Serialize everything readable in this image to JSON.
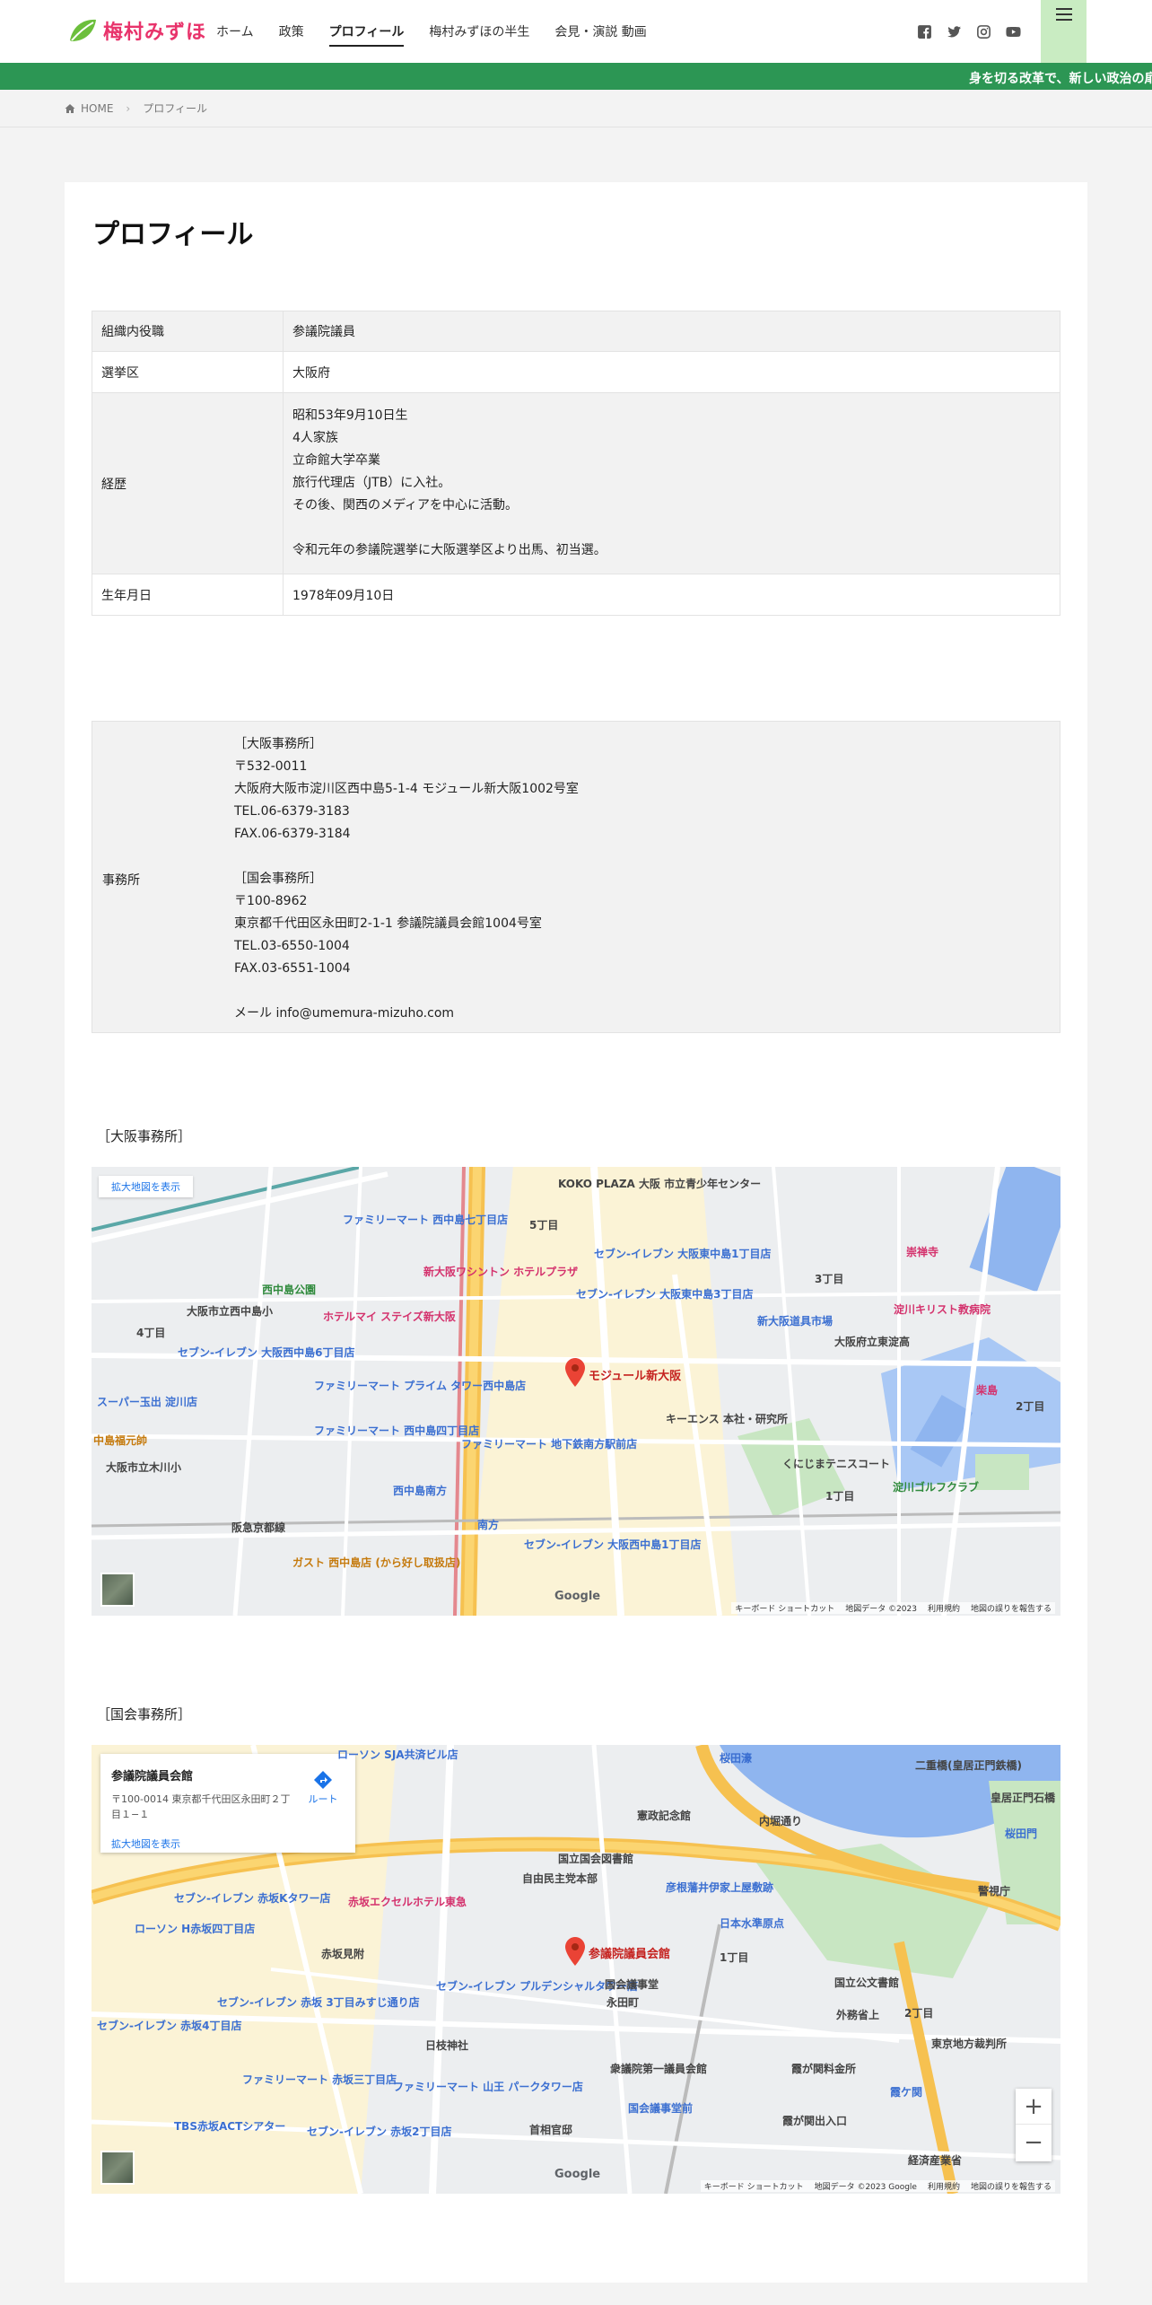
{
  "header": {
    "logo_text": "梅村みずほ",
    "nav": [
      "ホーム",
      "政策",
      "プロフィール",
      "梅村みずほの半生",
      "会見・演説 動画"
    ],
    "active_nav": "プロフィール"
  },
  "ticker": {
    "text": "身を切る改革で、新しい政治の扉"
  },
  "breadcrumb": {
    "home": "HOME",
    "current": "プロフィール"
  },
  "page": {
    "title": "プロフィール"
  },
  "profile_table": {
    "rows": [
      {
        "label": "組織内役職",
        "value": "参議院議員"
      },
      {
        "label": "選挙区",
        "value": "大阪府"
      },
      {
        "label": "経歴",
        "lines": [
          "昭和53年9月10日生",
          "4人家族",
          "立命館大学卒業",
          "旅行代理店（JTB）に入社。",
          "その後、関西のメディアを中心に活動。",
          "",
          "令和元年の参議院選挙に大阪選挙区より出馬、初当選。"
        ]
      },
      {
        "label": "生年月日",
        "value": "1978年09月10日"
      }
    ]
  },
  "office_table": {
    "label": "事務所",
    "lines": [
      "［大阪事務所］",
      "〒532-0011",
      "大阪府大阪市淀川区西中島5-1-4 モジュール新大阪1002号室",
      "TEL.06-6379-3183",
      "FAX.06-6379-3184",
      "",
      "［国会事務所］",
      "〒100-8962",
      "東京都千代田区永田町2-1-1 参議院議員会館1004号室",
      "TEL.03-6550-1004",
      "FAX.03-6551-1004",
      "",
      "メール info@umemura-mizuho.com"
    ]
  },
  "map_osaka": {
    "heading": "［大阪事務所］",
    "enlarge": "拡大地図を表示",
    "marker": "モジュール新大阪",
    "labels": [
      "ファミリーマート 西中島七丁目店",
      "KOKO PLAZA 大阪 市立青少年センター",
      "新大阪ワシントン ホテルプラザ",
      "セブン-イレブン 大阪東中島1丁目店",
      "セブン-イレブン 大阪東中島3丁目店",
      "崇禅寺",
      "淀川キリスト教病院",
      "新大阪道具市場",
      "大阪府立東淀高",
      "ホテルマイ ステイズ新大阪",
      "西中島公園",
      "大阪市立西中島小",
      "セブン-イレブン 大阪西中島6丁目店",
      "ファミリーマート プライム タワー西中島店",
      "スーパー玉出 淀川店",
      "キーエンス 本社・研究所",
      "くにじまテニスコート",
      "柴島",
      "ファミリーマート 西中島四丁目店",
      "ファミリーマート 地下鉄南方駅前店",
      "大阪市立木川小",
      "中島福元帥",
      "西中島南方",
      "南方",
      "阪急京都線",
      "セブン-イレブン 大阪西中島1丁目店",
      "淀川ゴルフクラブ",
      "ガスト 西中島店 (から好し取扱店)",
      "5丁目",
      "3丁目",
      "4丁目",
      "2丁目",
      "1丁目"
    ],
    "google": "Google",
    "footer": [
      "キーボード ショートカット",
      "地図データ ©2023",
      "利用規約",
      "地図の誤りを報告する"
    ]
  },
  "map_kokkai": {
    "heading": "［国会事務所］",
    "info_title": "参議院議員会館",
    "info_address": "〒100-0014 東京都千代田区永田町２丁目１−１",
    "info_route": "ルート",
    "enlarge": "拡大地図を表示",
    "marker": "参議院議員会館",
    "labels": [
      "ローソン SJA共済ビル店",
      "桜田濠",
      "憲政記念館",
      "内堀通り",
      "二重橋(皇居正門鉄橋)",
      "皇居正門石橋",
      "桜田門",
      "警視庁",
      "国立国会図書館",
      "自由民主党本部",
      "彦根藩井伊家上屋敷跡",
      "日本水準原点",
      "セブン-イレブン 赤坂Kタワー店",
      "ローソン H赤坂四丁目店",
      "赤坂エクセルホテル東急",
      "赤坂見附",
      "国立公文書館",
      "セブン-イレブン プルデンシャルタワー店",
      "国会議事堂",
      "永田町",
      "外務省上",
      "霞が関料金所",
      "日枝神社",
      "衆議院第一議員会館",
      "ファミリーマート 赤坂三丁目店",
      "ファミリーマート 山王 パークタワー店",
      "首相官邸",
      "国会議事堂前",
      "霞が関出入口",
      "東京地方裁判所",
      "霞ケ関",
      "経済産業省",
      "TBS赤坂ACTシアター",
      "セブン-イレブン 赤坂2丁目店",
      "セブン-イレブン 赤坂 3丁目みすじ通り店",
      "セブン-イレブン 赤坂4丁目店",
      "1丁目",
      "2丁目"
    ],
    "google": "Google",
    "footer": [
      "キーボード ショートカット",
      "地図データ ©2023 Google",
      "利用規約",
      "地図の誤りを報告する"
    ]
  },
  "colors": {
    "brand_pink": "#e8336b",
    "ticker_green": "#2c9654",
    "menu_bg": "#c9ecc2"
  },
  "icons": [
    "facebook-icon",
    "twitter-icon",
    "instagram-icon",
    "youtube-icon",
    "hamburger-icon",
    "home-icon",
    "map-pin-icon"
  ]
}
